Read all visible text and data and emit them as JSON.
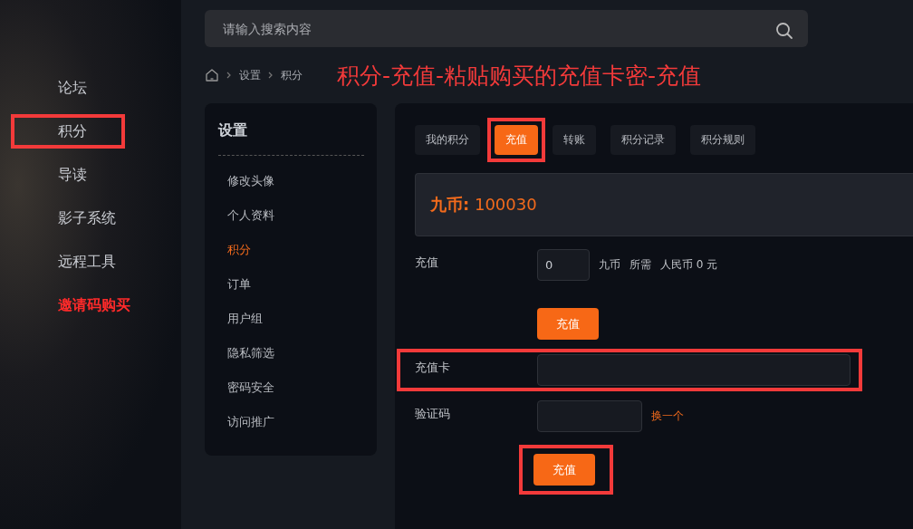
{
  "nav": [
    {
      "label": "论坛",
      "highlighted": false,
      "kind": "normal"
    },
    {
      "label": "积分",
      "highlighted": true,
      "kind": "normal"
    },
    {
      "label": "导读",
      "highlighted": false,
      "kind": "normal"
    },
    {
      "label": "影子系统",
      "highlighted": false,
      "kind": "normal"
    },
    {
      "label": "远程工具",
      "highlighted": false,
      "kind": "normal"
    },
    {
      "label": "邀请码购买",
      "highlighted": false,
      "kind": "promo"
    }
  ],
  "search": {
    "placeholder": "请输入搜索内容"
  },
  "breadcrumb": [
    "设置",
    "积分"
  ],
  "annotation": "积分-充值-粘贴购买的充值卡密-充值",
  "settings": {
    "title": "设置",
    "items": [
      {
        "label": "修改头像",
        "selected": false
      },
      {
        "label": "个人资料",
        "selected": false
      },
      {
        "label": "积分",
        "selected": true
      },
      {
        "label": "订单",
        "selected": false
      },
      {
        "label": "用户组",
        "selected": false
      },
      {
        "label": "隐私筛选",
        "selected": false
      },
      {
        "label": "密码安全",
        "selected": false
      },
      {
        "label": "访问推广",
        "selected": false
      }
    ]
  },
  "tabs": [
    {
      "label": "我的积分",
      "selected": false,
      "highlighted": false
    },
    {
      "label": "充值",
      "selected": true,
      "highlighted": true
    },
    {
      "label": "转账",
      "selected": false,
      "highlighted": false
    },
    {
      "label": "积分记录",
      "selected": false,
      "highlighted": false
    },
    {
      "label": "积分规则",
      "selected": false,
      "highlighted": false
    }
  ],
  "balance": {
    "label": "九币:",
    "value": "100030"
  },
  "recharge": {
    "label": "充值",
    "value": "0",
    "unit": "九币",
    "cost_label": "所需",
    "cost": "人民币 0 元",
    "button": "充值"
  },
  "card": {
    "label": "充值卡",
    "highlighted": true
  },
  "captcha": {
    "label": "验证码",
    "refresh": "换一个"
  },
  "submit": {
    "label": "充值",
    "highlighted": true
  }
}
